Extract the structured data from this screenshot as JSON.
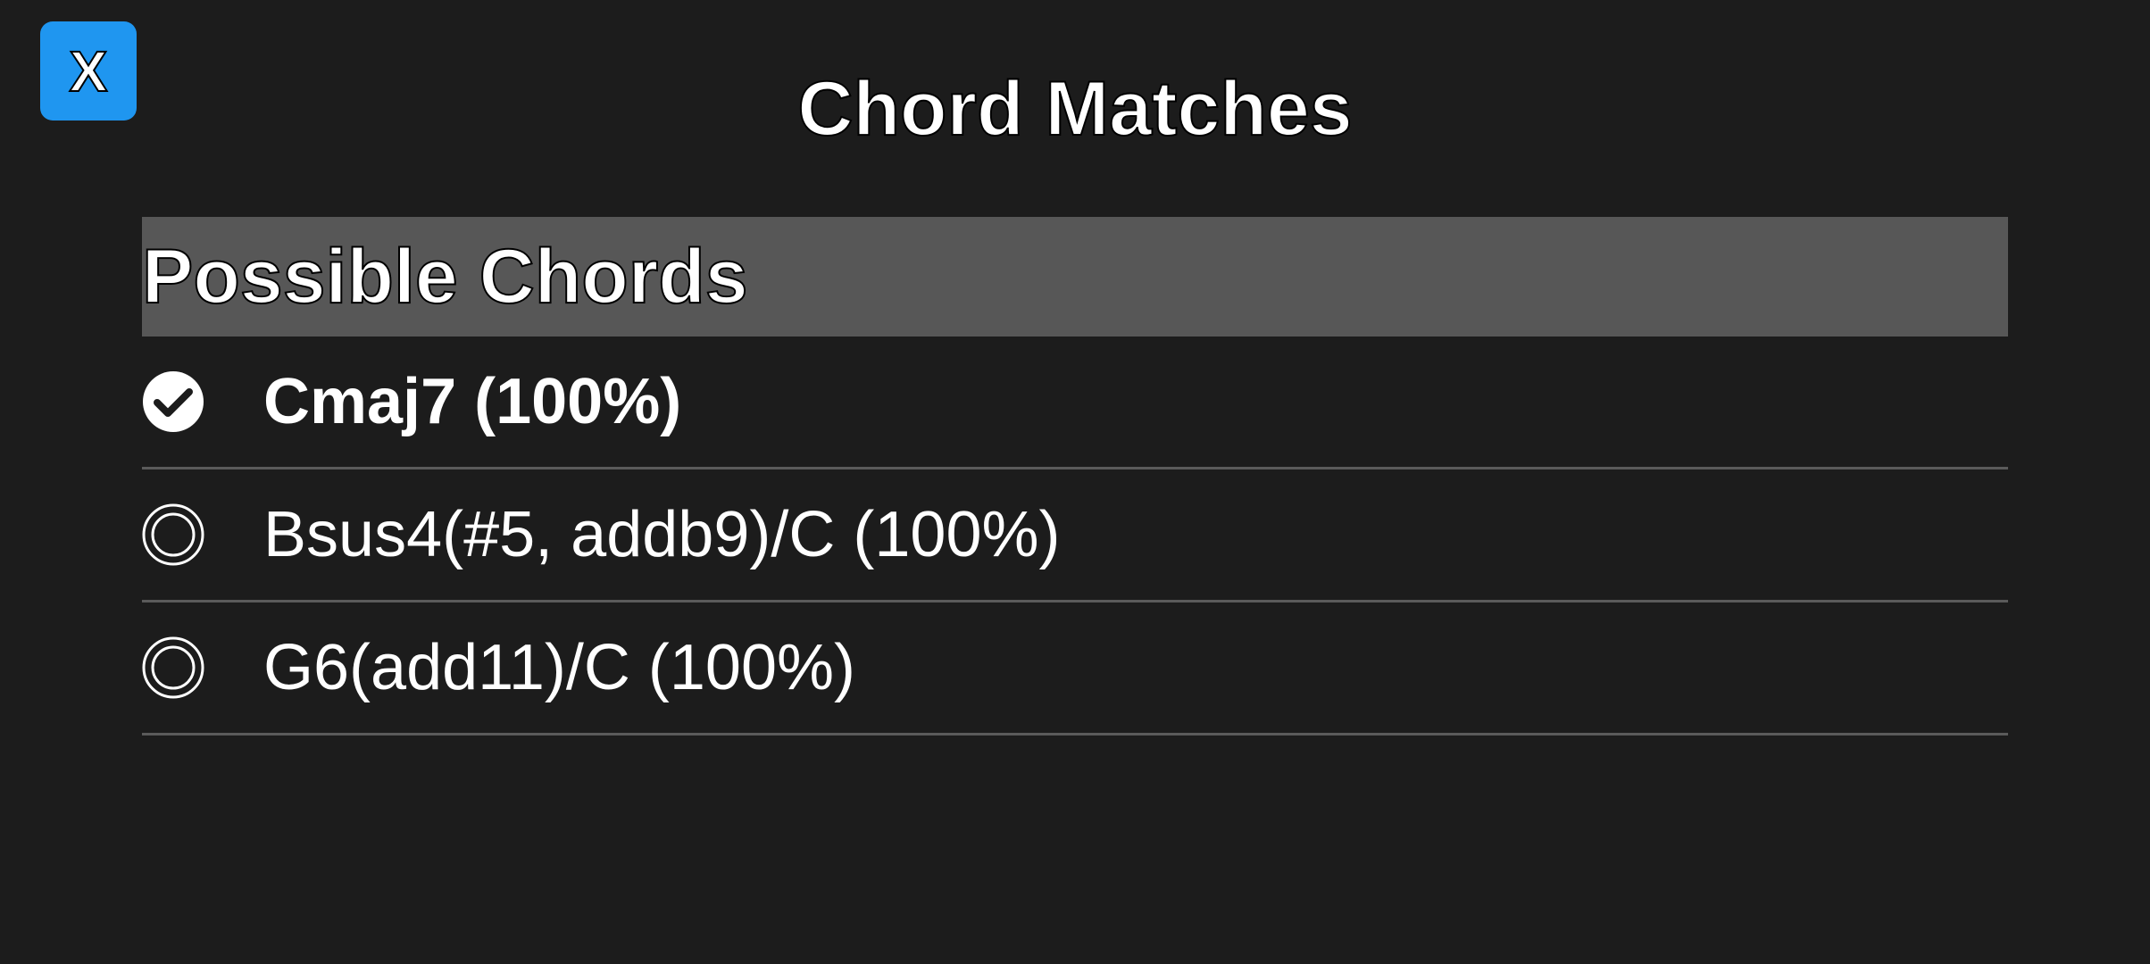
{
  "dialog": {
    "title": "Chord Matches",
    "close_label": "X"
  },
  "colors": {
    "background": "#1c1c1c",
    "accent": "#1f96f0",
    "header_bg": "#575757",
    "divider": "#5a5a5a"
  },
  "list": {
    "header": "Possible Chords",
    "items": [
      {
        "label": "Cmaj7 (100%)",
        "selected": true,
        "icon": "check-circle-icon"
      },
      {
        "label": "Bsus4(#5, addb9)/C (100%)",
        "selected": false,
        "icon": "radio-unchecked-icon"
      },
      {
        "label": "G6(add11)/C (100%)",
        "selected": false,
        "icon": "radio-unchecked-icon"
      }
    ]
  }
}
